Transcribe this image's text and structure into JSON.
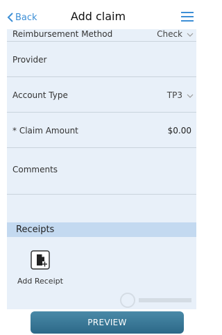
{
  "nav": {
    "back_label": "Back",
    "title": "Add claim"
  },
  "form": {
    "reimbursement_method": {
      "label": "Reimbursement Method",
      "value": "Check"
    },
    "provider": {
      "label": "Provider"
    },
    "account_type": {
      "label": "Account Type",
      "value": "TP3"
    },
    "claim_amount": {
      "label": "* Claim Amount",
      "value": "$0.00"
    },
    "comments": {
      "label": "Comments"
    }
  },
  "receipts": {
    "header": "Receipts",
    "add_label": "Add Receipt"
  },
  "preview_label": "PREVIEW",
  "colors": {
    "accent": "#3d8fd6",
    "form_background": "#e8f0f9",
    "section_header": "#c3d9f0",
    "button": "#357596"
  }
}
